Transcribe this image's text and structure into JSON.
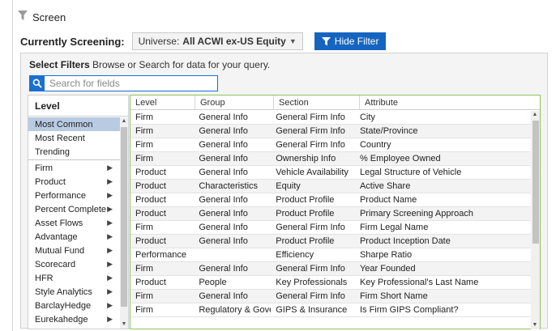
{
  "header": {
    "title": "Screen"
  },
  "screening": {
    "label": "Currently Screening:",
    "universe_prefix": "Universe:",
    "universe_value": "All ACWI ex-US Equity",
    "hide_filter_label": "Hide Filter"
  },
  "filters": {
    "select_title": "Select Filters",
    "select_hint": "Browse or Search for data for your query.",
    "search_placeholder": "Search for fields"
  },
  "level_panel": {
    "header": "Level",
    "quick_items": [
      {
        "label": "Most Common",
        "selected": true
      },
      {
        "label": "Most Recent",
        "selected": false
      },
      {
        "label": "Trending",
        "selected": false
      }
    ],
    "items": [
      {
        "label": "Firm"
      },
      {
        "label": "Product"
      },
      {
        "label": "Performance"
      },
      {
        "label": "Percent Complete"
      },
      {
        "label": "Asset Flows"
      },
      {
        "label": "Advantage"
      },
      {
        "label": "Mutual Fund"
      },
      {
        "label": "Scorecard"
      },
      {
        "label": "HFR"
      },
      {
        "label": "Style Analytics"
      },
      {
        "label": "BarclayHedge"
      },
      {
        "label": "Eurekahedge"
      }
    ]
  },
  "results": {
    "columns": [
      "Level",
      "Group",
      "Section",
      "Attribute"
    ],
    "rows": [
      [
        "Firm",
        "General Info",
        "General Firm Info",
        "City"
      ],
      [
        "Firm",
        "General Info",
        "General Firm Info",
        "State/Province"
      ],
      [
        "Firm",
        "General Info",
        "General Firm Info",
        "Country"
      ],
      [
        "Firm",
        "General Info",
        "Ownership Info",
        "% Employee Owned"
      ],
      [
        "Product",
        "General Info",
        "Vehicle Availability",
        "Legal Structure of Vehicle"
      ],
      [
        "Product",
        "Characteristics",
        "Equity",
        "Active Share"
      ],
      [
        "Product",
        "General Info",
        "Product Profile",
        "Product Name"
      ],
      [
        "Product",
        "General Info",
        "Product Profile",
        "Primary Screening Approach"
      ],
      [
        "Firm",
        "General Info",
        "General Firm Info",
        "Firm Legal Name"
      ],
      [
        "Product",
        "General Info",
        "Product Profile",
        "Product Inception Date"
      ],
      [
        "Performance",
        "",
        "Efficiency",
        "Sharpe Ratio"
      ],
      [
        "Firm",
        "General Info",
        "General Firm Info",
        "Year Founded"
      ],
      [
        "Product",
        "People",
        "Key Professionals",
        "Key Professional's Last Name"
      ],
      [
        "Firm",
        "General Info",
        "General Firm Info",
        "Firm Short Name"
      ],
      [
        "Firm",
        "Regulatory & Gover...",
        "GIPS & Insurance",
        "Is Firm GIPS Compliant?"
      ]
    ]
  },
  "colors": {
    "accent": "#1565c0",
    "selected_row": "#b9cbe3",
    "results_border": "#8fc45a"
  }
}
